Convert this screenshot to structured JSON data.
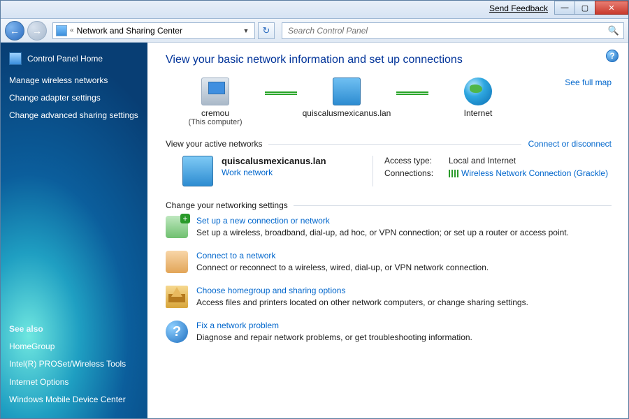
{
  "titlebar": {
    "feedback": "Send Feedback"
  },
  "nav": {
    "breadcrumb_prefix": "«",
    "breadcrumb": "Network and Sharing Center",
    "search_placeholder": "Search Control Panel"
  },
  "sidebar": {
    "home": "Control Panel Home",
    "links": [
      "Manage wireless networks",
      "Change adapter settings",
      "Change advanced sharing settings"
    ],
    "seealso_head": "See also",
    "seealso": [
      "HomeGroup",
      "Intel(R) PROSet/Wireless Tools",
      "Internet Options",
      "Windows Mobile Device Center"
    ]
  },
  "page": {
    "title": "View your basic network information and set up connections",
    "full_map": "See full map",
    "map": {
      "node1_name": "cremou",
      "node1_sub": "(This computer)",
      "node2_name": "quiscalusmexicanus.lan",
      "node3_name": "Internet"
    },
    "active_head": "View your active networks",
    "connect_link": "Connect or disconnect",
    "active": {
      "name": "quiscalusmexicanus.lan",
      "type": "Work network",
      "access_label": "Access type:",
      "access_value": "Local and Internet",
      "conn_label": "Connections:",
      "conn_value": "Wireless Network Connection (Grackle)"
    },
    "settings_head": "Change your networking settings",
    "settings": [
      {
        "title": "Set up a new connection or network",
        "desc": "Set up a wireless, broadband, dial-up, ad hoc, or VPN connection; or set up a router or access point."
      },
      {
        "title": "Connect to a network",
        "desc": "Connect or reconnect to a wireless, wired, dial-up, or VPN network connection."
      },
      {
        "title": "Choose homegroup and sharing options",
        "desc": "Access files and printers located on other network computers, or change sharing settings."
      },
      {
        "title": "Fix a network problem",
        "desc": "Diagnose and repair network problems, or get troubleshooting information."
      }
    ]
  }
}
